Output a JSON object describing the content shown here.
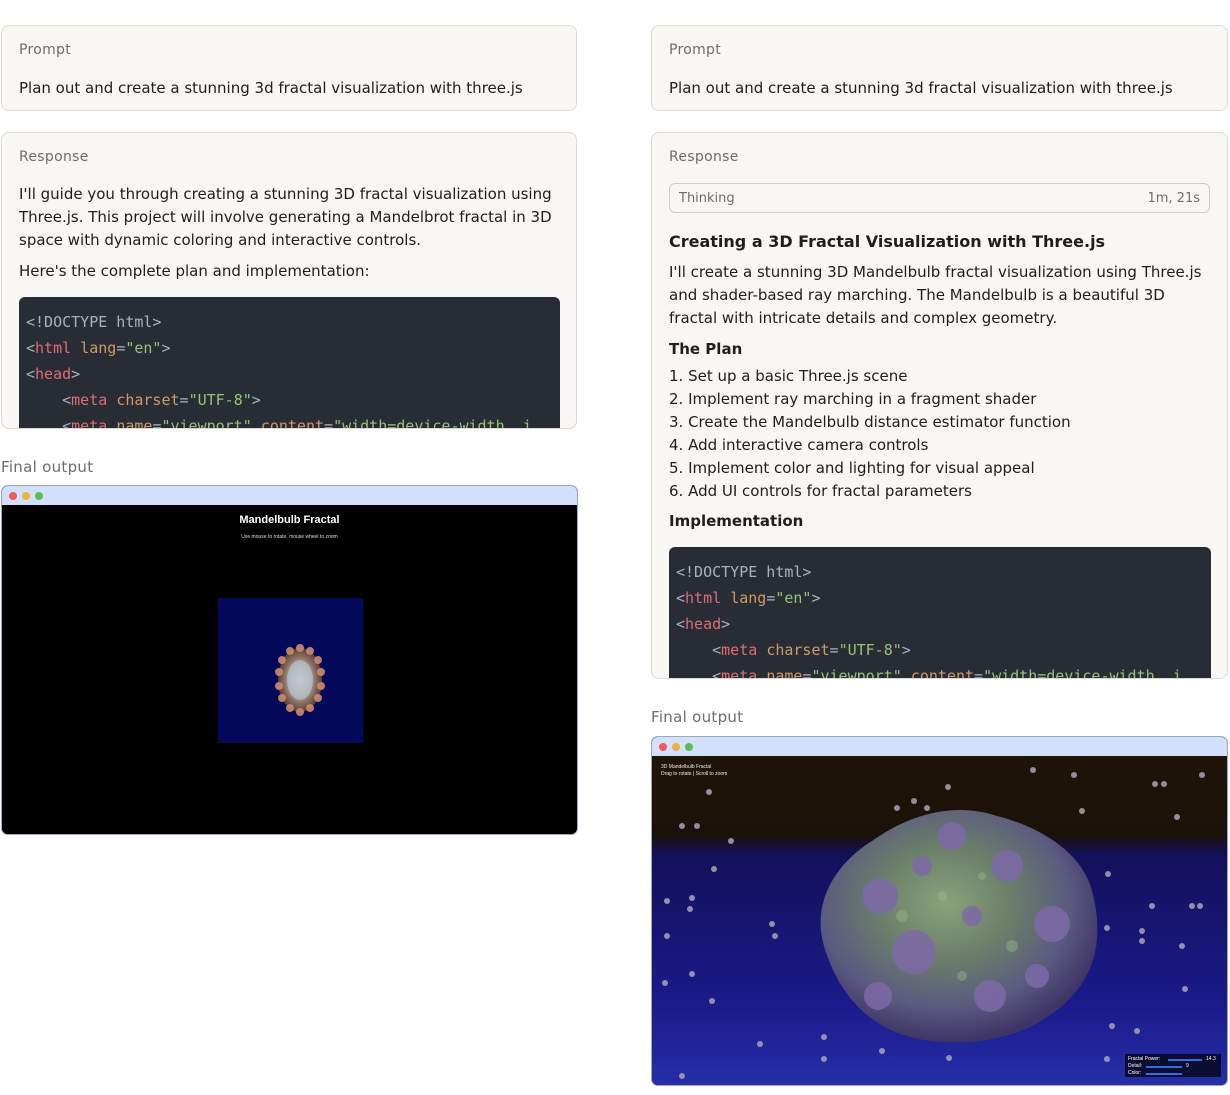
{
  "left": {
    "prompt": {
      "label": "Prompt",
      "text": "Plan out and create a stunning 3d fractal visualization with three.js"
    },
    "response": {
      "label": "Response",
      "paragraph1": "I'll guide you through creating a stunning 3D fractal visualization using Three.js. This project will involve generating a Mandelbrot fractal in 3D space with dynamic coloring and interactive controls.",
      "paragraph2": "Here's the complete plan and implementation:",
      "code": {
        "line1": "<!DOCTYPE html>",
        "line2_tag": "html",
        "line2_attr": "lang",
        "line2_val": "\"en\"",
        "line3_tag": "head",
        "line4_tag": "meta",
        "line4_attr": "charset",
        "line4_val": "\"UTF-8\"",
        "line5_tag": "meta",
        "line5_attr1": "name",
        "line5_val1": "\"viewport\"",
        "line5_attr2": "content",
        "line5_val2": "\"width=device-width, i"
      }
    },
    "final_output": {
      "label": "Final output",
      "title": "Mandelbulb Fractal",
      "subtitle": "Use mouse to rotate, mouse wheel to zoom"
    }
  },
  "right": {
    "prompt": {
      "label": "Prompt",
      "text": "Plan out and create a stunning 3d fractal visualization with three.js"
    },
    "response": {
      "label": "Response",
      "thinking_label": "Thinking",
      "thinking_time": "1m, 21s",
      "heading": "Creating a 3D Fractal Visualization with Three.js",
      "intro": "I'll create a stunning 3D Mandelbulb fractal visualization using Three.js and shader-based ray marching. The Mandelbulb is a beautiful 3D fractal with intricate details and complex geometry.",
      "plan_heading": "The Plan",
      "plan_items": [
        "1. Set up a basic Three.js scene",
        "2. Implement ray marching in a fragment shader",
        "3. Create the Mandelbulb distance estimator function",
        "4. Add interactive camera controls",
        "5. Implement color and lighting for visual appeal",
        "6. Add UI controls for fractal parameters"
      ],
      "impl_heading": "Implementation",
      "code": {
        "line1": "<!DOCTYPE html>",
        "line2_tag": "html",
        "line2_attr": "lang",
        "line2_val": "\"en\"",
        "line3_tag": "head",
        "line4_tag": "meta",
        "line4_attr": "charset",
        "line4_val": "\"UTF-8\"",
        "line5_tag": "meta",
        "line5_attr1": "name",
        "line5_val1": "\"viewport\"",
        "line5_attr2": "content",
        "line5_val2": "\"width=device-width, i"
      }
    },
    "final_output": {
      "label": "Final output",
      "overlay_title": "3D Mandelbulb Fractal",
      "overlay_hint": "Drag to rotate | Scroll to zoom",
      "controls": [
        {
          "label": "Fractal Power:",
          "value": "14.3",
          "fraction": 0.9
        },
        {
          "label": "Detail:",
          "value": "9",
          "fraction": 0.85
        },
        {
          "label": "Color:",
          "value": "",
          "fraction": 0.7
        }
      ]
    }
  }
}
